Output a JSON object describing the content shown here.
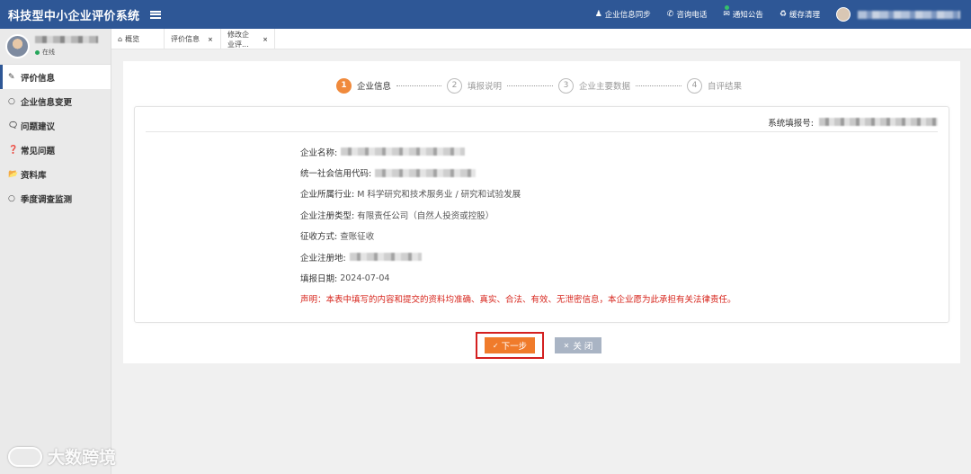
{
  "app": {
    "title": "科技型中小企业评价系统"
  },
  "topbar": {
    "actions": [
      {
        "icon": "user-icon",
        "label": "企业信息同步"
      },
      {
        "icon": "phone-icon",
        "label": "咨询电话"
      },
      {
        "icon": "mail-icon",
        "label": "通知公告"
      },
      {
        "icon": "recycle-icon",
        "label": "缓存清理"
      }
    ]
  },
  "sidebar": {
    "status": "在线",
    "items": [
      {
        "icon": "edit-icon",
        "label": "评价信息",
        "active": true
      },
      {
        "icon": "circle-icon",
        "label": "企业信息变更"
      },
      {
        "icon": "comment-icon",
        "label": "问题建议"
      },
      {
        "icon": "question-icon",
        "label": "常见问题"
      },
      {
        "icon": "folder-icon",
        "label": "资料库"
      },
      {
        "icon": "circle-icon",
        "label": "季度调查监测"
      }
    ]
  },
  "tabs": [
    {
      "label": "概览",
      "icon": "home-icon"
    },
    {
      "label": "评价信息",
      "close": "×"
    },
    {
      "label": "修改企业评...",
      "close": "×"
    }
  ],
  "steps": [
    {
      "num": "1",
      "label": "企业信息",
      "active": true
    },
    {
      "num": "2",
      "label": "填报说明"
    },
    {
      "num": "3",
      "label": "企业主要数据"
    },
    {
      "num": "4",
      "label": "自评结果"
    }
  ],
  "form": {
    "system_no_label": "系统填报号:",
    "fields": [
      {
        "label": "企业名称:",
        "value": ""
      },
      {
        "label": "统一社会信用代码:",
        "value": ""
      },
      {
        "label": "企业所属行业:",
        "value": "M 科学研究和技术服务业 / 研究和试验发展"
      },
      {
        "label": "企业注册类型:",
        "value": "有限责任公司（自然人投资或控股）"
      },
      {
        "label": "征收方式:",
        "value": "查账征收"
      },
      {
        "label": "企业注册地:",
        "value": ""
      },
      {
        "label": "填报日期:",
        "value": "2024-07-04"
      }
    ],
    "declaration": "声明：本表中填写的内容和提交的资料均准确、真实、合法、有效、无泄密信息，本企业愿为此承担有关法律责任。"
  },
  "buttons": {
    "next": "下一步",
    "close": "关 闭"
  },
  "watermark": "大数跨境",
  "colors": {
    "header": "#2e5796",
    "accent": "#f07b2b",
    "highlight": "#d42020",
    "declaration": "#d7261d"
  }
}
